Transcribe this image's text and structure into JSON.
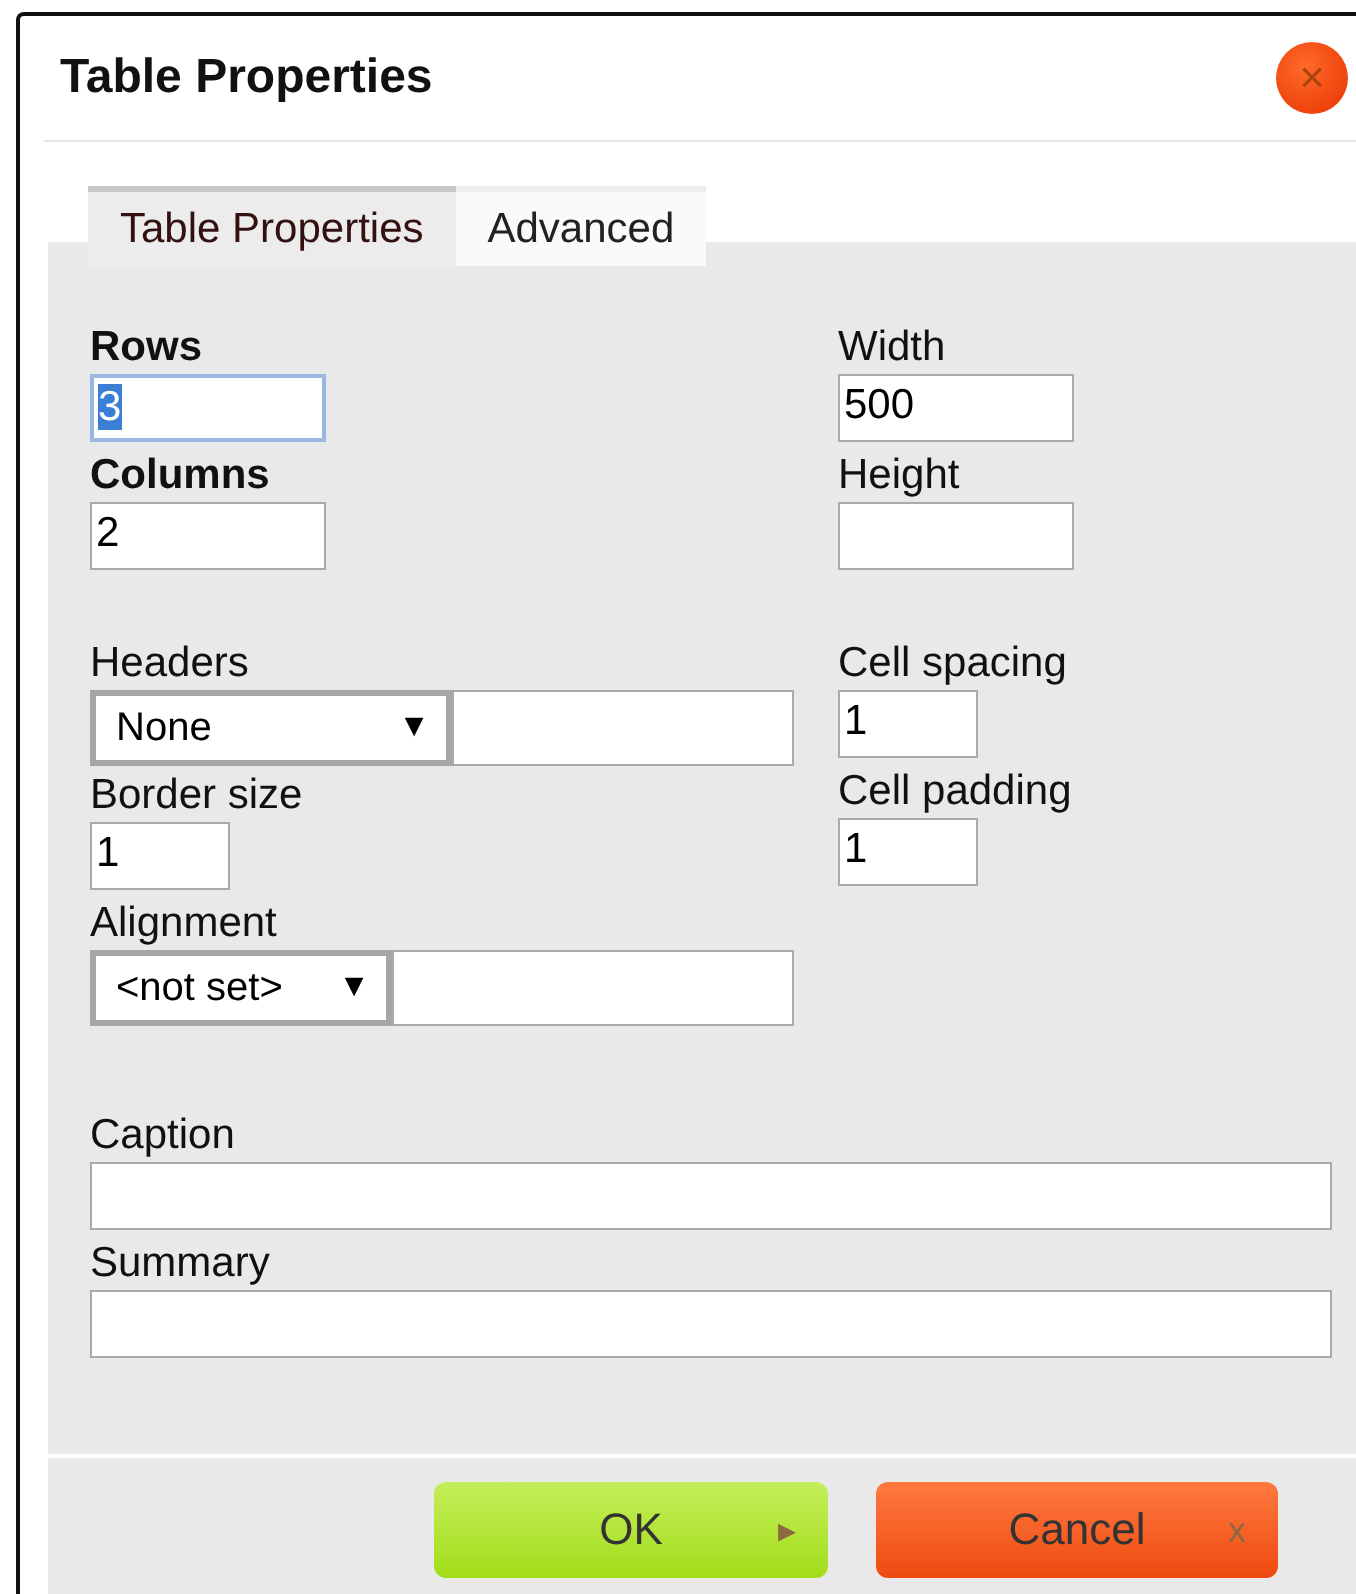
{
  "window": {
    "title": "Table Properties",
    "close": "×"
  },
  "tabs": [
    {
      "label": "Table Properties",
      "selected": true
    },
    {
      "label": "Advanced",
      "selected": false
    }
  ],
  "left_fields": [
    {
      "kind": "text",
      "label": "Rows",
      "bold": true,
      "value": "3",
      "focused": true
    },
    {
      "kind": "text",
      "label": "Columns",
      "bold": true,
      "value": "2",
      "focused": false
    },
    {
      "kind": "select",
      "label": "Headers",
      "bold": false,
      "value": "None",
      "arrow": "▼"
    },
    {
      "kind": "text",
      "label": "Border size",
      "bold": false,
      "value": "1",
      "focused": false
    },
    {
      "kind": "select",
      "label": "Alignment",
      "bold": false,
      "value": "<not set>",
      "arrow": "▼"
    }
  ],
  "right_fields": [
    {
      "kind": "text",
      "label": "Width",
      "value": "500",
      "focused": false
    },
    {
      "kind": "text",
      "label": "Height",
      "focused": false
    },
    {
      "kind": "text",
      "label": "Cell spacing",
      "value": "1",
      "focused": false
    },
    {
      "kind": "text",
      "label": "Cell padding",
      "value": "1",
      "focused": false
    }
  ],
  "wide_fields": [
    {
      "label": "Caption"
    },
    {
      "label": "Summary"
    }
  ],
  "buttons": [
    {
      "kind": "ok",
      "label": "OK",
      "icon": "▸"
    },
    {
      "kind": "cancel",
      "label": "Cancel",
      "icon": "x"
    }
  ]
}
